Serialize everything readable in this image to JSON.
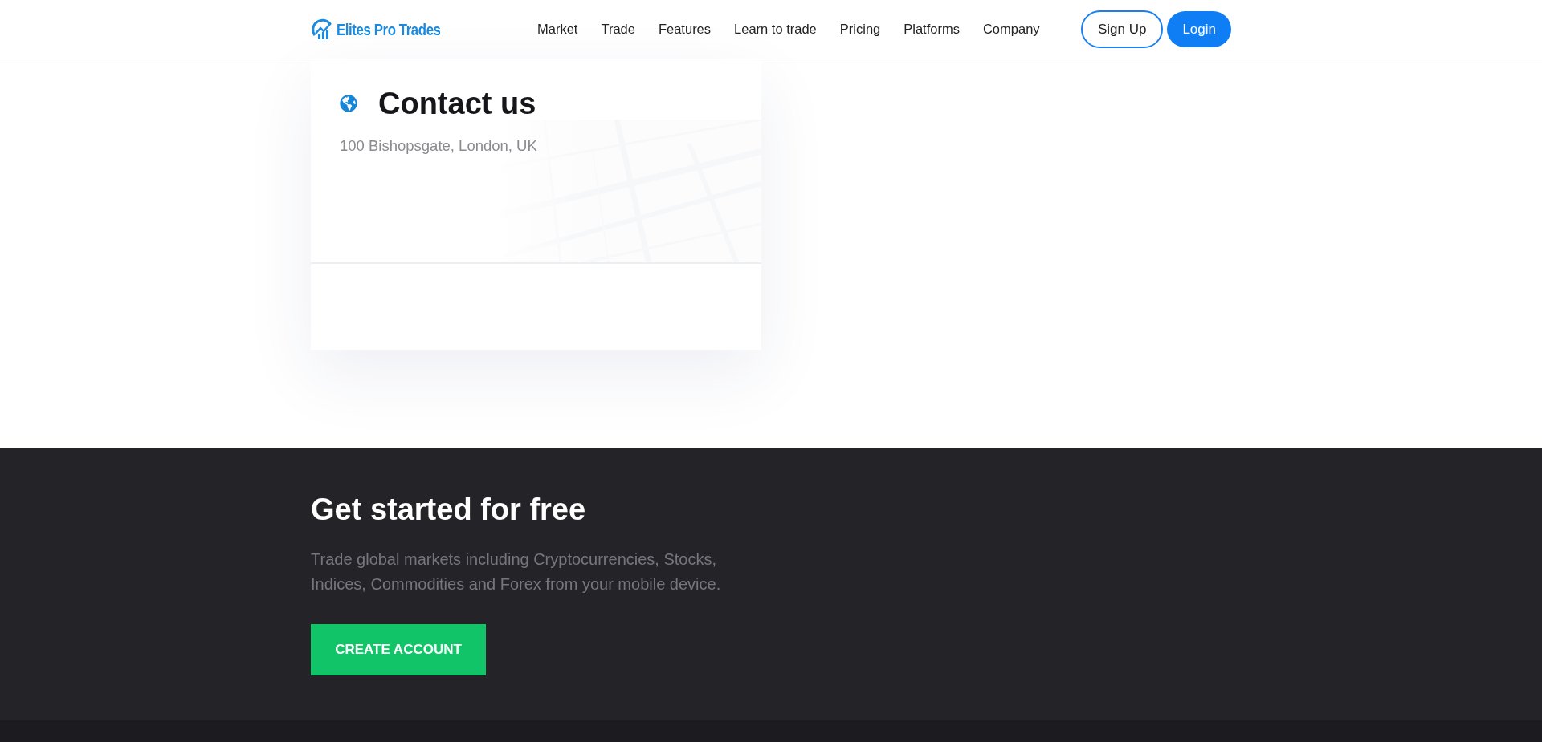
{
  "header": {
    "logo": "Elites Pro Trades",
    "nav": [
      "Market",
      "Trade",
      "Features",
      "Learn to trade",
      "Pricing",
      "Platforms",
      "Company"
    ],
    "buttons": [
      {
        "label": "Sign Up",
        "kind": "outline"
      },
      {
        "label": "Login",
        "kind": "solid"
      }
    ]
  },
  "contact_card": {
    "title": "Contact us",
    "address": "100 Bishopsgate, London, UK"
  },
  "cta": {
    "title": "Get started for free",
    "text": "Trade global markets including Cryptocurrencies, Stocks, Indices, Commodities and Forex from your mobile device.",
    "button": "CREATE ACCOUNT"
  }
}
